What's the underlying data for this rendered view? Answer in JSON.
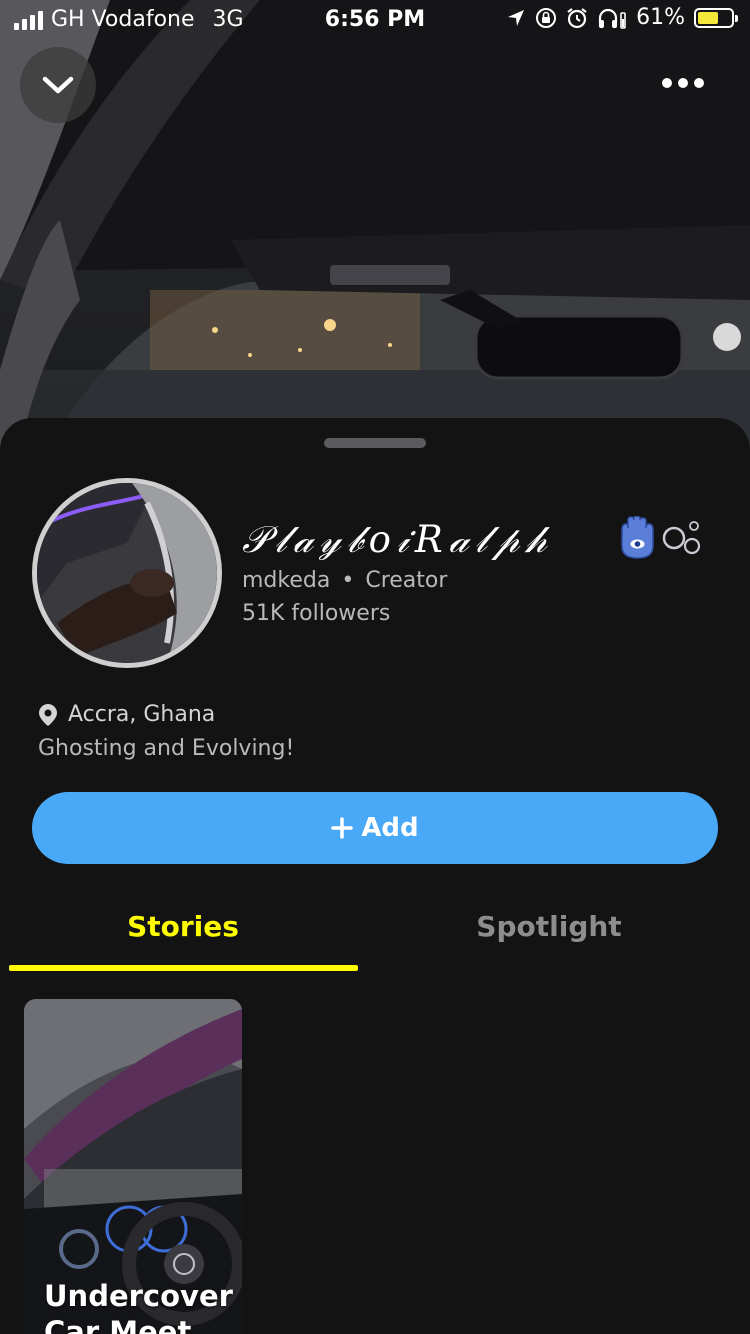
{
  "status_bar": {
    "carrier": "GH Vodafone",
    "network": "3G",
    "time": "6:56 PM",
    "battery": "61%",
    "battery_level": 0.61
  },
  "header": {
    "collapse_icon": "chevron-down-icon",
    "more_icon": "more-horizontal-icon"
  },
  "profile": {
    "display_name": "𝒫𝓁𝒶𝓎𝒷𝑜𝒾𝑅𝒶𝓁𝓅𝒽",
    "display_emoji": "🪬🫧",
    "username": "mdkeda",
    "separator": "•",
    "role": "Creator",
    "followers": "51K followers",
    "location": "Accra, Ghana",
    "bio": "Ghosting and Evolving!"
  },
  "actions": {
    "add_label": "Add",
    "add_icon": "plus-icon"
  },
  "tabs": [
    {
      "label": "Stories",
      "active": true
    },
    {
      "label": "Spotlight",
      "active": false
    }
  ],
  "stories": [
    {
      "title": "Undercover Car Meet"
    }
  ],
  "colors": {
    "accent_blue": "#4aa9f7",
    "active_tab": "#fffc00",
    "sheet_bg": "#131314"
  }
}
